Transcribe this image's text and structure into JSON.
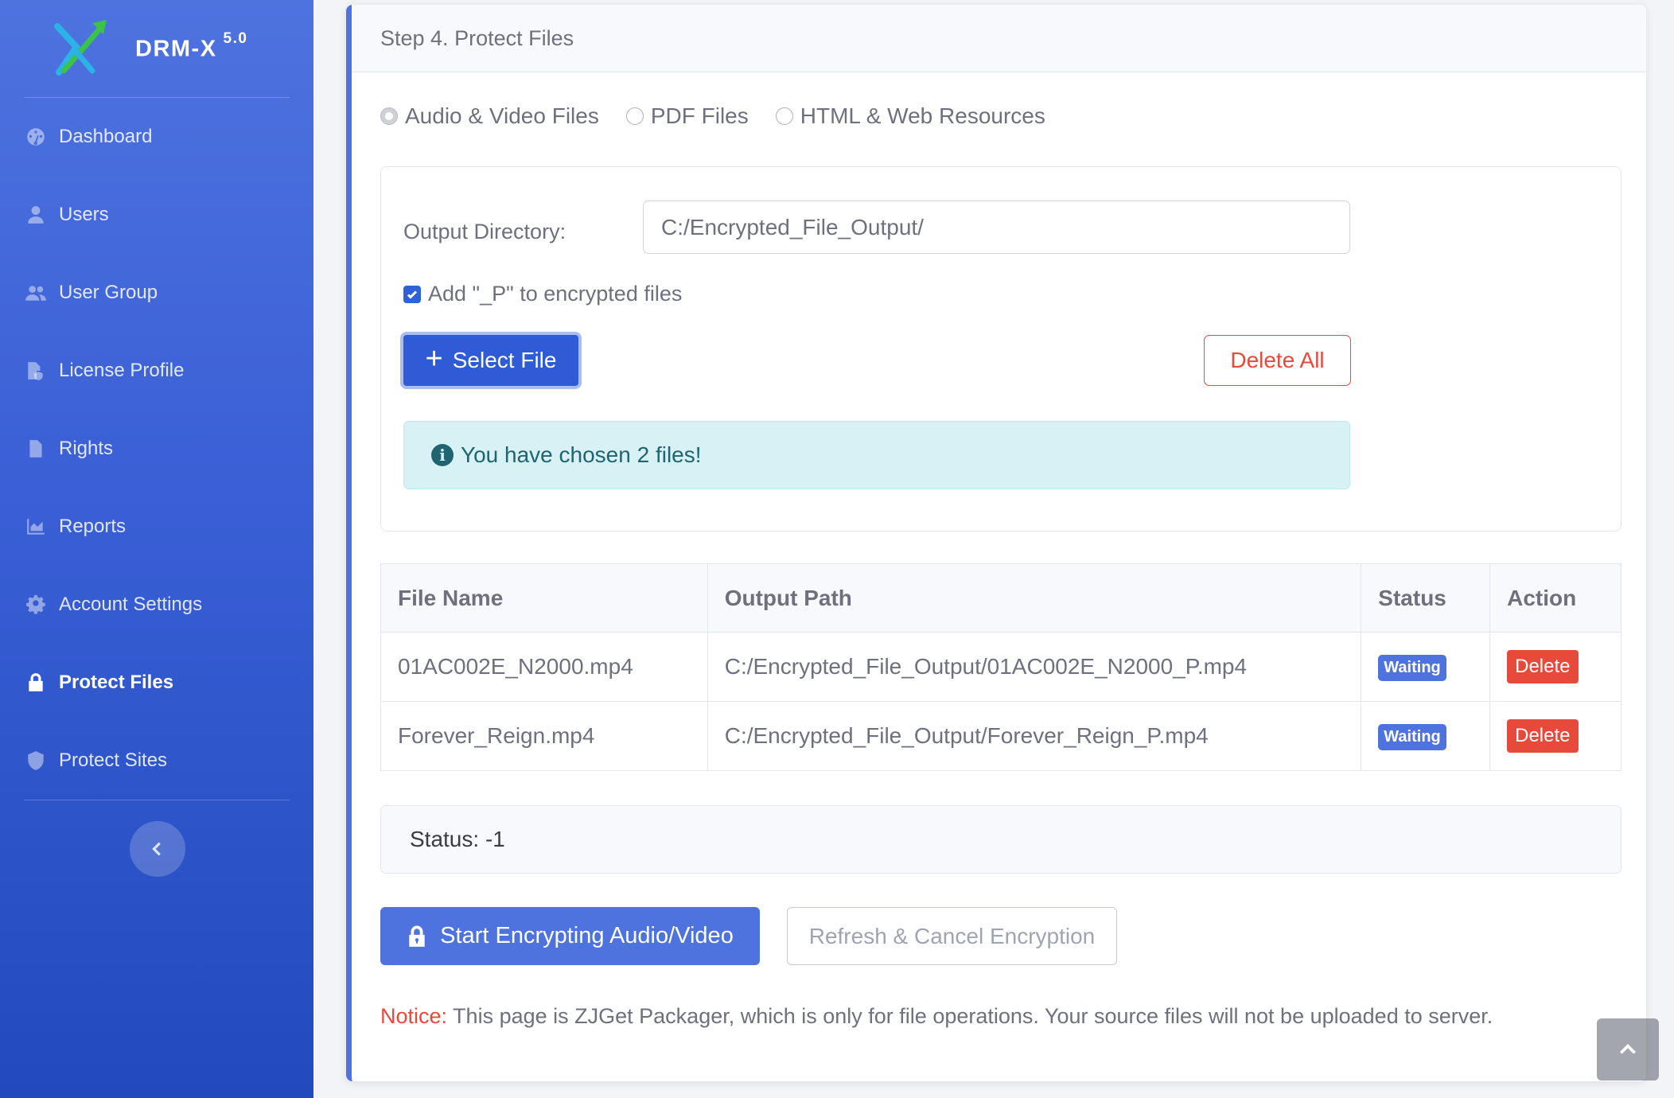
{
  "brand": {
    "name": "DRM-X",
    "version": "5.0"
  },
  "sidebar": {
    "items": [
      {
        "label": "Dashboard",
        "icon": "dashboard-icon",
        "active": false
      },
      {
        "label": "Users",
        "icon": "user-icon",
        "active": false
      },
      {
        "label": "User Group",
        "icon": "users-group-icon",
        "active": false
      },
      {
        "label": "License Profile",
        "icon": "file-shield-icon",
        "active": false
      },
      {
        "label": "Rights",
        "icon": "document-icon",
        "active": false
      },
      {
        "label": "Reports",
        "icon": "area-chart-icon",
        "active": false
      },
      {
        "label": "Account Settings",
        "icon": "gear-icon",
        "active": false
      },
      {
        "label": "Protect Files",
        "icon": "lock-icon",
        "active": true
      },
      {
        "label": "Protect Sites",
        "icon": "shield-icon",
        "active": false
      }
    ],
    "toggle_icon": "chevron-left-icon"
  },
  "card": {
    "title": "Step 4. Protect Files"
  },
  "file_types": {
    "options": [
      "Audio & Video Files",
      "PDF Files",
      "HTML & Web Resources"
    ],
    "selected": "Audio & Video Files"
  },
  "output": {
    "label": "Output Directory:",
    "value": "C:/Encrypted_File_Output/",
    "checkbox_label": "Add \"_P\" to encrypted files",
    "checkbox_checked": true
  },
  "buttons": {
    "select_file": "Select File",
    "delete_all": "Delete All",
    "start": "Start Encrypting Audio/Video",
    "refresh_cancel": "Refresh & Cancel Encryption"
  },
  "alert": {
    "text": "You have chosen 2 files!",
    "icon": "info-circle-icon"
  },
  "table": {
    "headers": [
      "File Name",
      "Output Path",
      "Status",
      "Action"
    ],
    "rows": [
      {
        "file_name": "01AC002E_N2000.mp4",
        "output_path": "C:/Encrypted_File_Output/01AC002E_N2000_P.mp4",
        "status": "Waiting",
        "action": "Delete"
      },
      {
        "file_name": "Forever_Reign.mp4",
        "output_path": "C:/Encrypted_File_Output/Forever_Reign_P.mp4",
        "status": "Waiting",
        "action": "Delete"
      }
    ]
  },
  "status": {
    "text": "Status: -1"
  },
  "notice": {
    "label": "Notice:",
    "text": " This page is ZJGet Packager, which is only for file operations. Your source files will not be uploaded to server."
  },
  "colors": {
    "primary": "#4e73df",
    "danger": "#e74a3b",
    "info_bg": "#d7f1f4"
  },
  "scroll_top_icon": "chevron-up-icon"
}
